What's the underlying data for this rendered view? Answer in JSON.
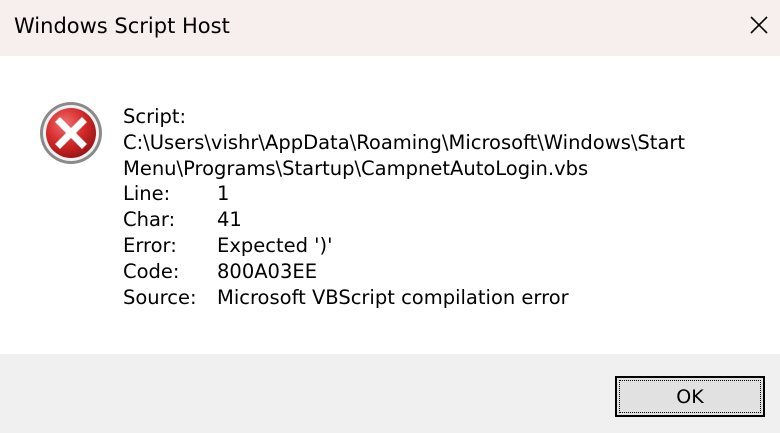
{
  "window": {
    "title": "Windows Script Host",
    "close_icon": "close-icon"
  },
  "dialog": {
    "icon": "error-icon",
    "script_label": "Script:",
    "script_path_line1": "C:\\Users\\vishr\\AppData\\Roaming\\Microsoft\\Windows\\Start",
    "script_path_line2": "Menu\\Programs\\Startup\\CampnetAutoLogin.vbs",
    "fields": [
      {
        "label": "Line:",
        "value": "1"
      },
      {
        "label": "Char:",
        "value": "41"
      },
      {
        "label": "Error:",
        "value": "Expected ')'"
      },
      {
        "label": "Code:",
        "value": "800A03EE"
      },
      {
        "label": "Source:",
        "value": "Microsoft VBScript compilation error"
      }
    ]
  },
  "buttons": {
    "ok_label": "OK"
  },
  "colors": {
    "titlebar_bg": "#f7eeee",
    "footer_bg": "#f0f0f0",
    "error_red": "#d62a2a"
  }
}
